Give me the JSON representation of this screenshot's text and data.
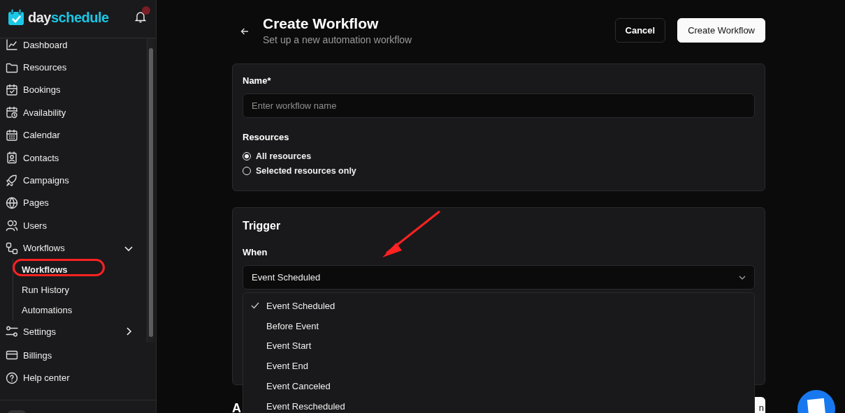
{
  "sidebar": {
    "logo": {
      "first": "day",
      "second": "schedule"
    },
    "nav": [
      {
        "label": "Dashboard"
      },
      {
        "label": "Resources"
      },
      {
        "label": "Bookings"
      },
      {
        "label": "Availability"
      },
      {
        "label": "Calendar"
      },
      {
        "label": "Contacts"
      },
      {
        "label": "Campaigns"
      },
      {
        "label": "Pages"
      },
      {
        "label": "Users"
      },
      {
        "label": "Workflows",
        "expanded": true,
        "children": [
          {
            "label": "Workflows"
          },
          {
            "label": "Run History"
          },
          {
            "label": "Automations"
          }
        ]
      },
      {
        "label": "Settings",
        "expanded": false
      }
    ],
    "footer_nav": [
      {
        "label": "Billings"
      },
      {
        "label": "Help center"
      }
    ]
  },
  "header": {
    "title": "Create Workflow",
    "subtitle": "Set up a new automation workflow",
    "buttons": [
      {
        "label": "Cancel",
        "kind": "secondary"
      },
      {
        "label": "Create Workflow",
        "kind": "primary"
      }
    ]
  },
  "details_card": {
    "name_label": "Name*",
    "name_placeholder": "Enter workflow name",
    "resources_label": "Resources",
    "resource_options": [
      {
        "label": "All resources",
        "selected": true
      },
      {
        "label": "Selected resources only",
        "selected": false
      }
    ]
  },
  "trigger_card": {
    "title": "Trigger",
    "when_label": "When",
    "when_value": "Event Scheduled",
    "options": [
      {
        "label": "Event Scheduled",
        "selected": true
      },
      {
        "label": "Before Event",
        "selected": false
      },
      {
        "label": "Event Start",
        "selected": false
      },
      {
        "label": "Event End",
        "selected": false
      },
      {
        "label": "Event Canceled",
        "selected": false
      },
      {
        "label": "Event Rescheduled",
        "selected": false
      }
    ]
  },
  "next_section": {
    "heading": "A",
    "button": "n"
  }
}
